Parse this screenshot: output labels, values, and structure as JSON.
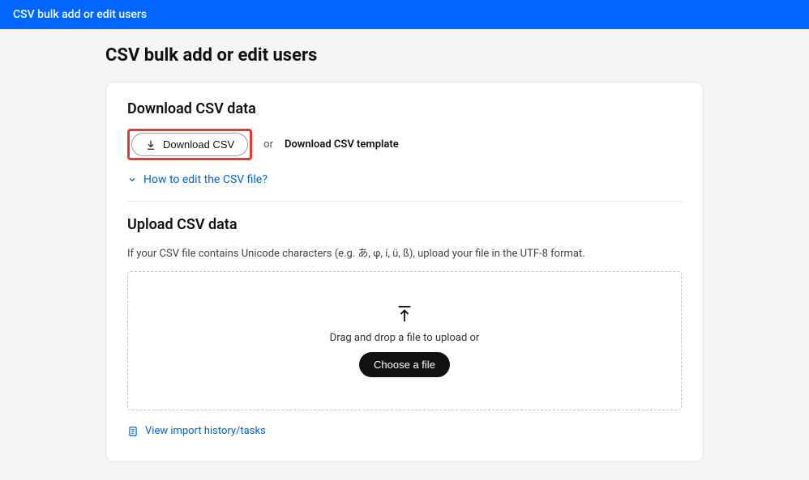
{
  "topbar": {
    "title": "CSV bulk add or edit users"
  },
  "page": {
    "title": "CSV bulk add or edit users"
  },
  "download": {
    "heading": "Download CSV data",
    "button_label": "Download CSV",
    "or_text": "or",
    "template_link": "Download CSV template",
    "how_to_link": "How to edit the CSV file?"
  },
  "upload": {
    "heading": "Upload CSV data",
    "help_text": "If your CSV file contains Unicode characters (e.g. あ, φ, í, ü, ß), upload your file in the UTF-8 format.",
    "drop_text": "Drag and drop a file to upload or",
    "choose_label": "Choose a file"
  },
  "footer": {
    "history_link": "View import history/tasks"
  }
}
